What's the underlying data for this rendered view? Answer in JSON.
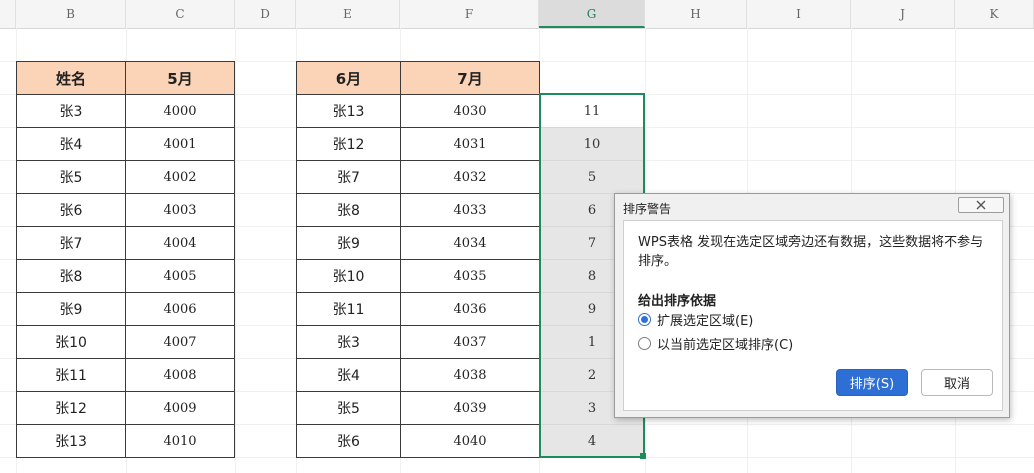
{
  "columns": {
    "B": "B",
    "C": "C",
    "D": "D",
    "E": "E",
    "F": "F",
    "G": "G",
    "H": "H",
    "I": "I",
    "J": "J",
    "K": "K"
  },
  "table1": {
    "headers": [
      "姓名",
      "5月"
    ],
    "rows": [
      [
        "张3",
        "4000"
      ],
      [
        "张4",
        "4001"
      ],
      [
        "张5",
        "4002"
      ],
      [
        "张6",
        "4003"
      ],
      [
        "张7",
        "4004"
      ],
      [
        "张8",
        "4005"
      ],
      [
        "张9",
        "4006"
      ],
      [
        "张10",
        "4007"
      ],
      [
        "张11",
        "4008"
      ],
      [
        "张12",
        "4009"
      ],
      [
        "张13",
        "4010"
      ]
    ]
  },
  "table2": {
    "headers": [
      "6月",
      "7月"
    ],
    "rows": [
      [
        "张13",
        "4030"
      ],
      [
        "张12",
        "4031"
      ],
      [
        "张7",
        "4032"
      ],
      [
        "张8",
        "4033"
      ],
      [
        "张9",
        "4034"
      ],
      [
        "张10",
        "4035"
      ],
      [
        "张11",
        "4036"
      ],
      [
        "张3",
        "4037"
      ],
      [
        "张4",
        "4038"
      ],
      [
        "张5",
        "4039"
      ],
      [
        "张6",
        "4040"
      ]
    ]
  },
  "column_g": [
    "11",
    "10",
    "5",
    "6",
    "7",
    "8",
    "9",
    "1",
    "2",
    "3",
    "4"
  ],
  "dialog": {
    "title": "排序警告",
    "message": "WPS表格 发现在选定区域旁边还有数据，这些数据将不参与排序。",
    "subheading": "给出排序依据",
    "options": [
      {
        "label": "扩展选定区域(E)",
        "checked": true
      },
      {
        "label": "以当前选定区域排序(C)",
        "checked": false
      }
    ],
    "sort_button": "排序(S)",
    "cancel_button": "取消",
    "close_icon": "close-icon"
  },
  "colors": {
    "header_fill": "#fbd3b6",
    "selection_border": "#1e8b5c",
    "primary_button": "#2d6fd5"
  }
}
